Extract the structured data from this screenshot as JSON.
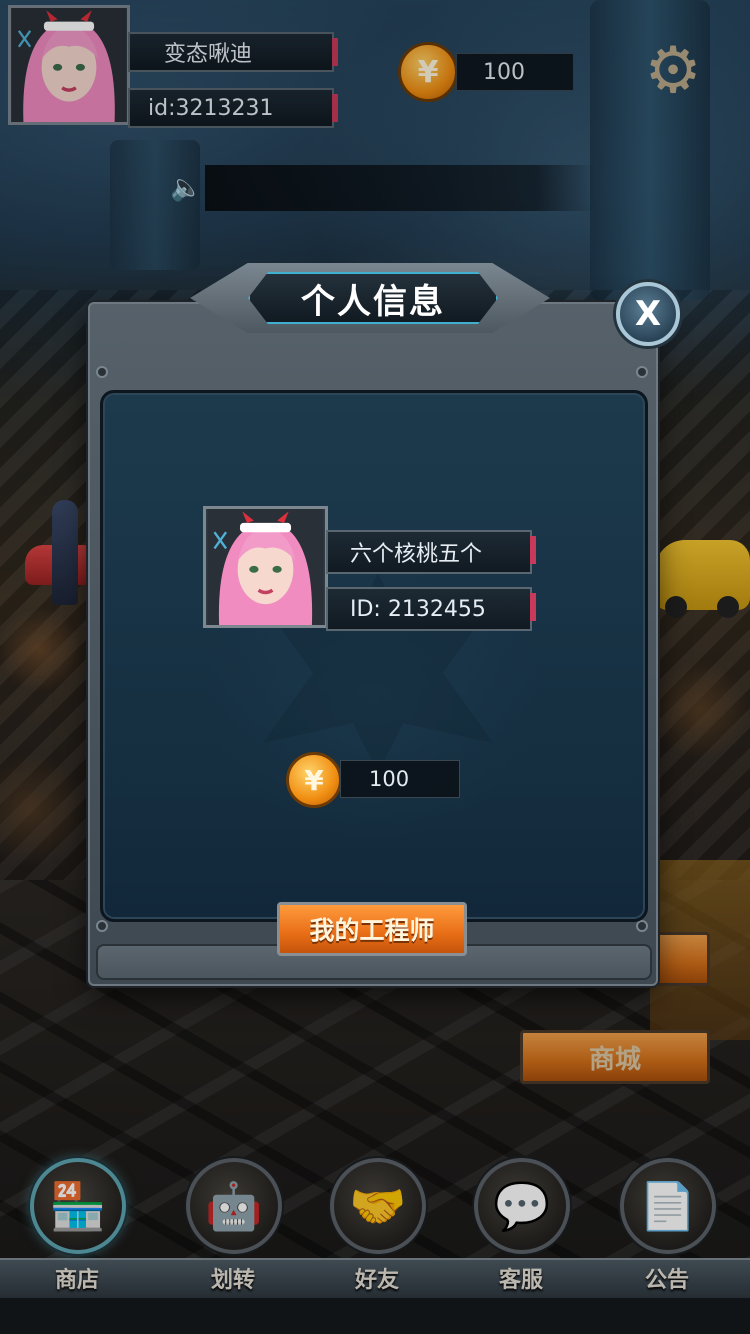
{
  "header": {
    "player_name": "变态啾迪",
    "player_id": "id:3213231",
    "coins": "100",
    "settings_icon": "gear-icon",
    "announcement_icon": "speaker-icon"
  },
  "modal": {
    "title": "个人信息",
    "close_label": "X",
    "profile": {
      "name": "六个核桃五个",
      "id": "ID: 2132455",
      "coins": "100"
    },
    "engineer_button": "我的工程师"
  },
  "side_buttons": {
    "shop": "商城"
  },
  "coin_symbol": "¥",
  "nav": [
    {
      "label": "商店",
      "icon": "storefront-icon",
      "active": true
    },
    {
      "label": "划转",
      "icon": "robot-icon"
    },
    {
      "label": "好友",
      "icon": "handshake-icon"
    },
    {
      "label": "客服",
      "icon": "chat-icon"
    },
    {
      "label": "公告",
      "icon": "document-icon"
    }
  ],
  "colors": {
    "accent_orange": "#e86e16",
    "panel_blue": "#163042",
    "title_glow": "#3fb0d0"
  }
}
